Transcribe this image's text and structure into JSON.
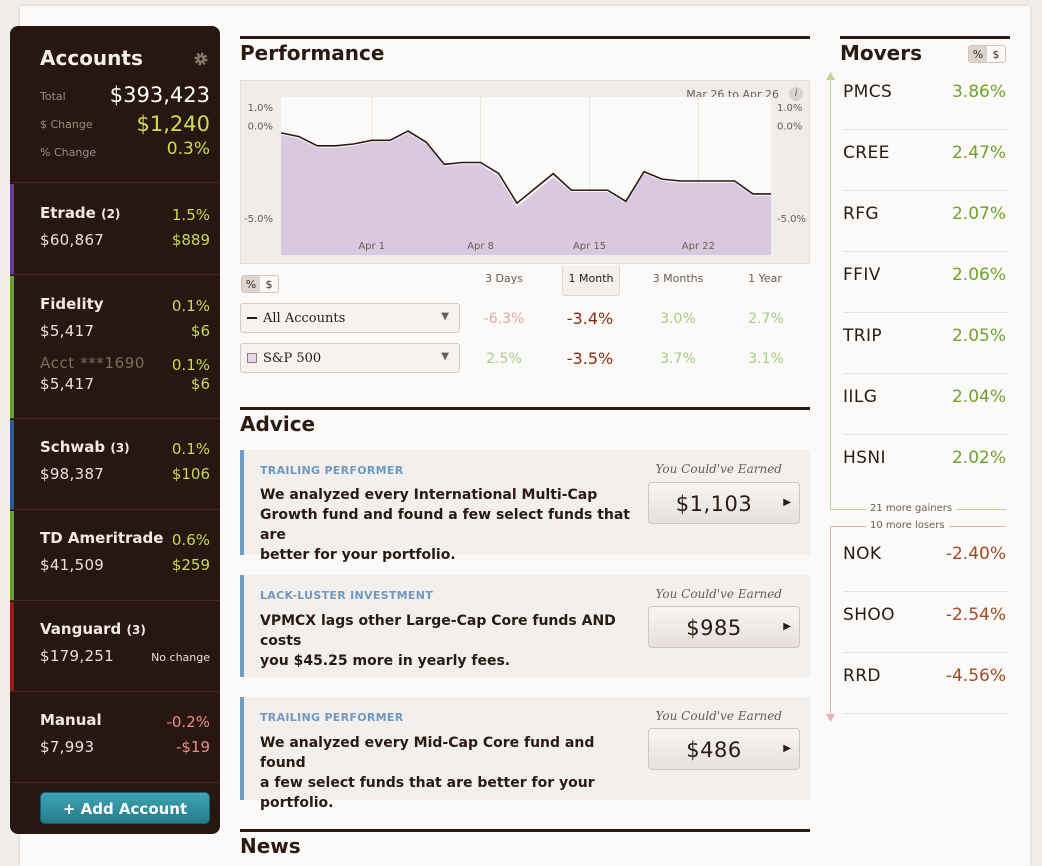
{
  "sidebar": {
    "title": "Accounts",
    "total_label": "Total",
    "total_value": "$393,423",
    "change_label": "$ Change",
    "change_value": "$1,240",
    "pct_label": "% Change",
    "pct_value": "0.3%",
    "accounts": [
      {
        "name": "Etrade",
        "count": "(2)",
        "amount": "$60,867",
        "pct": "1.5%",
        "change": "$889",
        "color": "#6a3a9e"
      },
      {
        "name": "Fidelity",
        "count": "",
        "amount": "$5,417",
        "pct": "0.1%",
        "change": "$6",
        "sub_name": "Acct ***1690",
        "sub_amount": "$5,417",
        "sub_pct": "0.1%",
        "sub_change": "$6",
        "color": "#6d9e2d"
      },
      {
        "name": "Schwab",
        "count": "(3)",
        "amount": "$98,387",
        "pct": "0.1%",
        "change": "$106",
        "color": "#2c5c9a"
      },
      {
        "name": "TD Ameritrade",
        "count": "",
        "amount": "$41,509",
        "pct": "0.6%",
        "change": "$259",
        "color": "#6d9e2d"
      },
      {
        "name": "Vanguard",
        "count": "(3)",
        "amount": "$179,251",
        "pct": "",
        "change": "No change",
        "color": "#9e1a1a"
      },
      {
        "name": "Manual",
        "count": "",
        "amount": "$7,993",
        "pct": "-0.2%",
        "change": "-$19",
        "color": ""
      }
    ],
    "add_button": "+ Add Account"
  },
  "performance": {
    "title": "Performance",
    "date_range": "Mar 26 to Apr 26",
    "info": "i",
    "toggle": {
      "pct": "%",
      "usd": "$"
    },
    "tabs": [
      "3 Days",
      "1 Month",
      "3 Months",
      "1 Year"
    ],
    "rows": [
      {
        "label": "All Accounts",
        "values": [
          "-6.3%",
          "-3.4%",
          "3.0%",
          "2.7%"
        ]
      },
      {
        "label": "S&P 500",
        "values": [
          "2.5%",
          "-3.5%",
          "3.7%",
          "3.1%"
        ]
      }
    ]
  },
  "chart_data": {
    "type": "area",
    "x": [
      "Mar 26",
      "Mar 27",
      "Mar 28",
      "Mar 29",
      "Mar 30",
      "Apr 1",
      "Apr 2",
      "Apr 3",
      "Apr 4",
      "Apr 5",
      "Apr 7",
      "Apr 8",
      "Apr 9",
      "Apr 10",
      "Apr 11",
      "Apr 12",
      "Apr 14",
      "Apr 15",
      "Apr 16",
      "Apr 17",
      "Apr 18",
      "Apr 19",
      "Apr 21",
      "Apr 22",
      "Apr 23",
      "Apr 24",
      "Apr 25",
      "Apr 26"
    ],
    "x_ticks": [
      "Apr 1",
      "Apr 8",
      "Apr 15",
      "Apr 22"
    ],
    "y_ticks_left": [
      "1.0%",
      "0.0%",
      "-5.0%"
    ],
    "y_ticks_right": [
      "1.0%",
      "0.0%",
      "-5.0%"
    ],
    "ylim": [
      -7.0,
      1.0
    ],
    "series": [
      {
        "values": [
          -0.4,
          -0.6,
          -1.1,
          -1.1,
          -1.0,
          -0.8,
          -0.8,
          -0.3,
          -0.9,
          -2.1,
          -2.0,
          -2.0,
          -2.6,
          -4.2,
          -3.4,
          -2.6,
          -3.5,
          -3.5,
          -3.5,
          -4.1,
          -2.5,
          -2.9,
          -3.0,
          -3.0,
          -3.0,
          -3.0,
          -3.7,
          -3.7
        ],
        "color": "#2a1a12"
      },
      {
        "values": [
          -0.5,
          -0.7,
          -1.2,
          -1.2,
          -1.1,
          -0.9,
          -0.9,
          -0.4,
          -1.0,
          -2.2,
          -2.1,
          -2.1,
          -2.8,
          -4.4,
          -3.6,
          -2.8,
          -3.6,
          -3.6,
          -3.6,
          -4.2,
          -2.6,
          -3.0,
          -3.1,
          -3.1,
          -3.1,
          -3.1,
          -3.8,
          -3.8
        ],
        "color": "#d9c8df"
      }
    ]
  },
  "advice": {
    "title": "Advice",
    "caption": "You Could've Earned",
    "items": [
      {
        "kind": "TRAILING PERFORMER",
        "line1": "We analyzed every International Multi-Cap",
        "line2": "Growth fund and found a few select funds that are",
        "line3": "better for your portfolio.",
        "earned": "$1,103"
      },
      {
        "kind": "LACK-LUSTER INVESTMENT",
        "line1": "VPMCX lags other Large-Cap Core funds AND costs",
        "line2": "you $45.25 more in yearly fees.",
        "line3": "",
        "earned": "$985"
      },
      {
        "kind": "TRAILING PERFORMER",
        "line1": "We analyzed every Mid-Cap Core fund and found",
        "line2": "a few select funds that are better for your portfolio.",
        "line3": "",
        "earned": "$486"
      }
    ]
  },
  "news": {
    "title": "News"
  },
  "movers": {
    "title": "Movers",
    "toggle": {
      "pct": "%",
      "usd": "$"
    },
    "gainers": [
      {
        "symbol": "PMCS",
        "pct": "3.86%"
      },
      {
        "symbol": "CREE",
        "pct": "2.47%"
      },
      {
        "symbol": "RFG",
        "pct": "2.07%"
      },
      {
        "symbol": "FFIV",
        "pct": "2.06%"
      },
      {
        "symbol": "TRIP",
        "pct": "2.05%"
      },
      {
        "symbol": "IILG",
        "pct": "2.04%"
      },
      {
        "symbol": "HSNI",
        "pct": "2.02%"
      }
    ],
    "more_gainers": "21 more gainers",
    "more_losers": "10 more losers",
    "losers": [
      {
        "symbol": "NOK",
        "pct": "-2.40%"
      },
      {
        "symbol": "SHOO",
        "pct": "-2.54%"
      },
      {
        "symbol": "RRD",
        "pct": "-4.56%"
      }
    ]
  }
}
